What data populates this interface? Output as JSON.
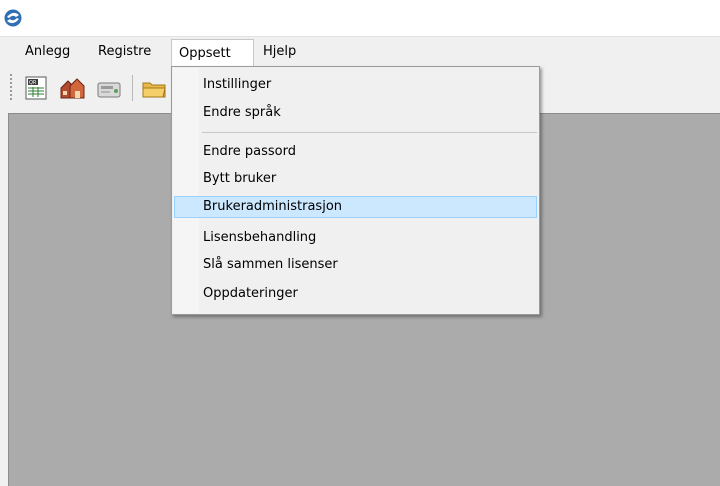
{
  "app": {
    "icon": "app-logo-icon"
  },
  "menubar": {
    "items": [
      {
        "label": "Anlegg"
      },
      {
        "label": "Registre"
      },
      {
        "label": "Oppsett",
        "open": true
      },
      {
        "label": "Hjelp"
      }
    ]
  },
  "toolbar": {
    "buttons": [
      {
        "icon": "qr-report-icon"
      },
      {
        "icon": "buildings-icon"
      },
      {
        "icon": "card-reader-icon"
      },
      {
        "icon": "folder-icon"
      }
    ]
  },
  "dropdown": {
    "items": [
      {
        "label": "Instillinger"
      },
      {
        "label": "Endre språk"
      },
      {
        "label": "Endre passord"
      },
      {
        "label": "Bytt bruker"
      },
      {
        "label": "Brukeradministrasjon",
        "highlighted": true
      },
      {
        "label": "Lisensbehandling"
      },
      {
        "label": "Slå sammen lisenser"
      },
      {
        "label": "Oppdateringer"
      }
    ]
  },
  "colors": {
    "background": "#f0f0f0",
    "workspace": "#ababab",
    "highlight": "#cce8ff",
    "highlight_border": "#99d1ff"
  }
}
